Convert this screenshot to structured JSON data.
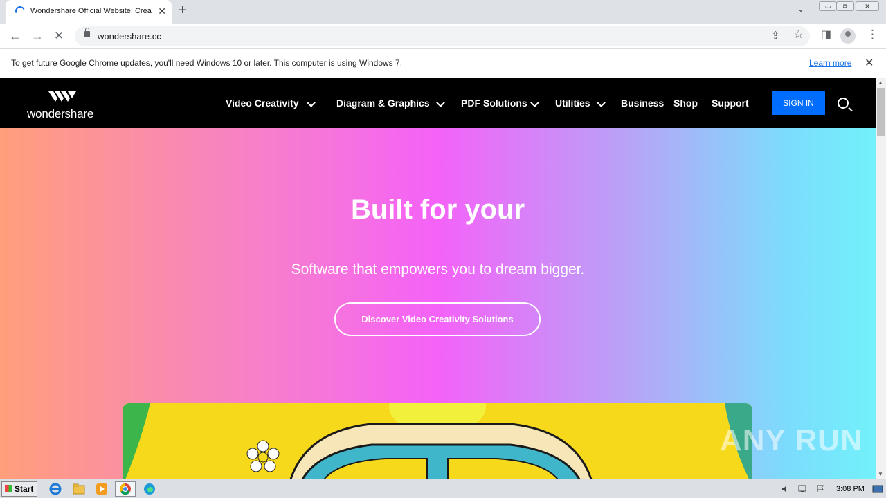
{
  "browser": {
    "tab": {
      "title": "Wondershare Official Website: Crea",
      "close_glyph": "✕"
    },
    "new_tab_glyph": "+",
    "tab_search_glyph": "⌄",
    "window_buttons": [
      "▭",
      "⧉",
      "✕"
    ],
    "back_glyph": "←",
    "forward_glyph": "→",
    "stop_glyph": "✕",
    "address": "wondershare.cc",
    "share_glyph": "⇪",
    "star_glyph": "☆",
    "sidepanel_glyph": "◨",
    "menu_glyph": "⋮"
  },
  "infobar": {
    "message": "To get future Google Chrome updates, you'll need Windows 10 or later. This computer is using Windows 7.",
    "link": "Learn more",
    "close_glyph": "✕"
  },
  "site": {
    "logo_text": "wondershare",
    "nav": [
      {
        "label": "Video Creativity"
      },
      {
        "label": "Diagram & Graphics"
      },
      {
        "label": "PDF Solutions"
      },
      {
        "label": "Utilities"
      },
      {
        "label": "Business"
      },
      {
        "label": "Shop"
      },
      {
        "label": "Support"
      }
    ],
    "signin": "SIGN IN",
    "hero": {
      "title": "Built for your",
      "subtitle": "Software that empowers you to dream bigger.",
      "cta": "Discover Video Creativity Solutions"
    }
  },
  "watermark": "ANY RUN",
  "taskbar": {
    "start": "Start",
    "clock": "3:08 PM"
  },
  "colors": {
    "accent_blue": "#006dff",
    "nav_bg": "#000000"
  }
}
